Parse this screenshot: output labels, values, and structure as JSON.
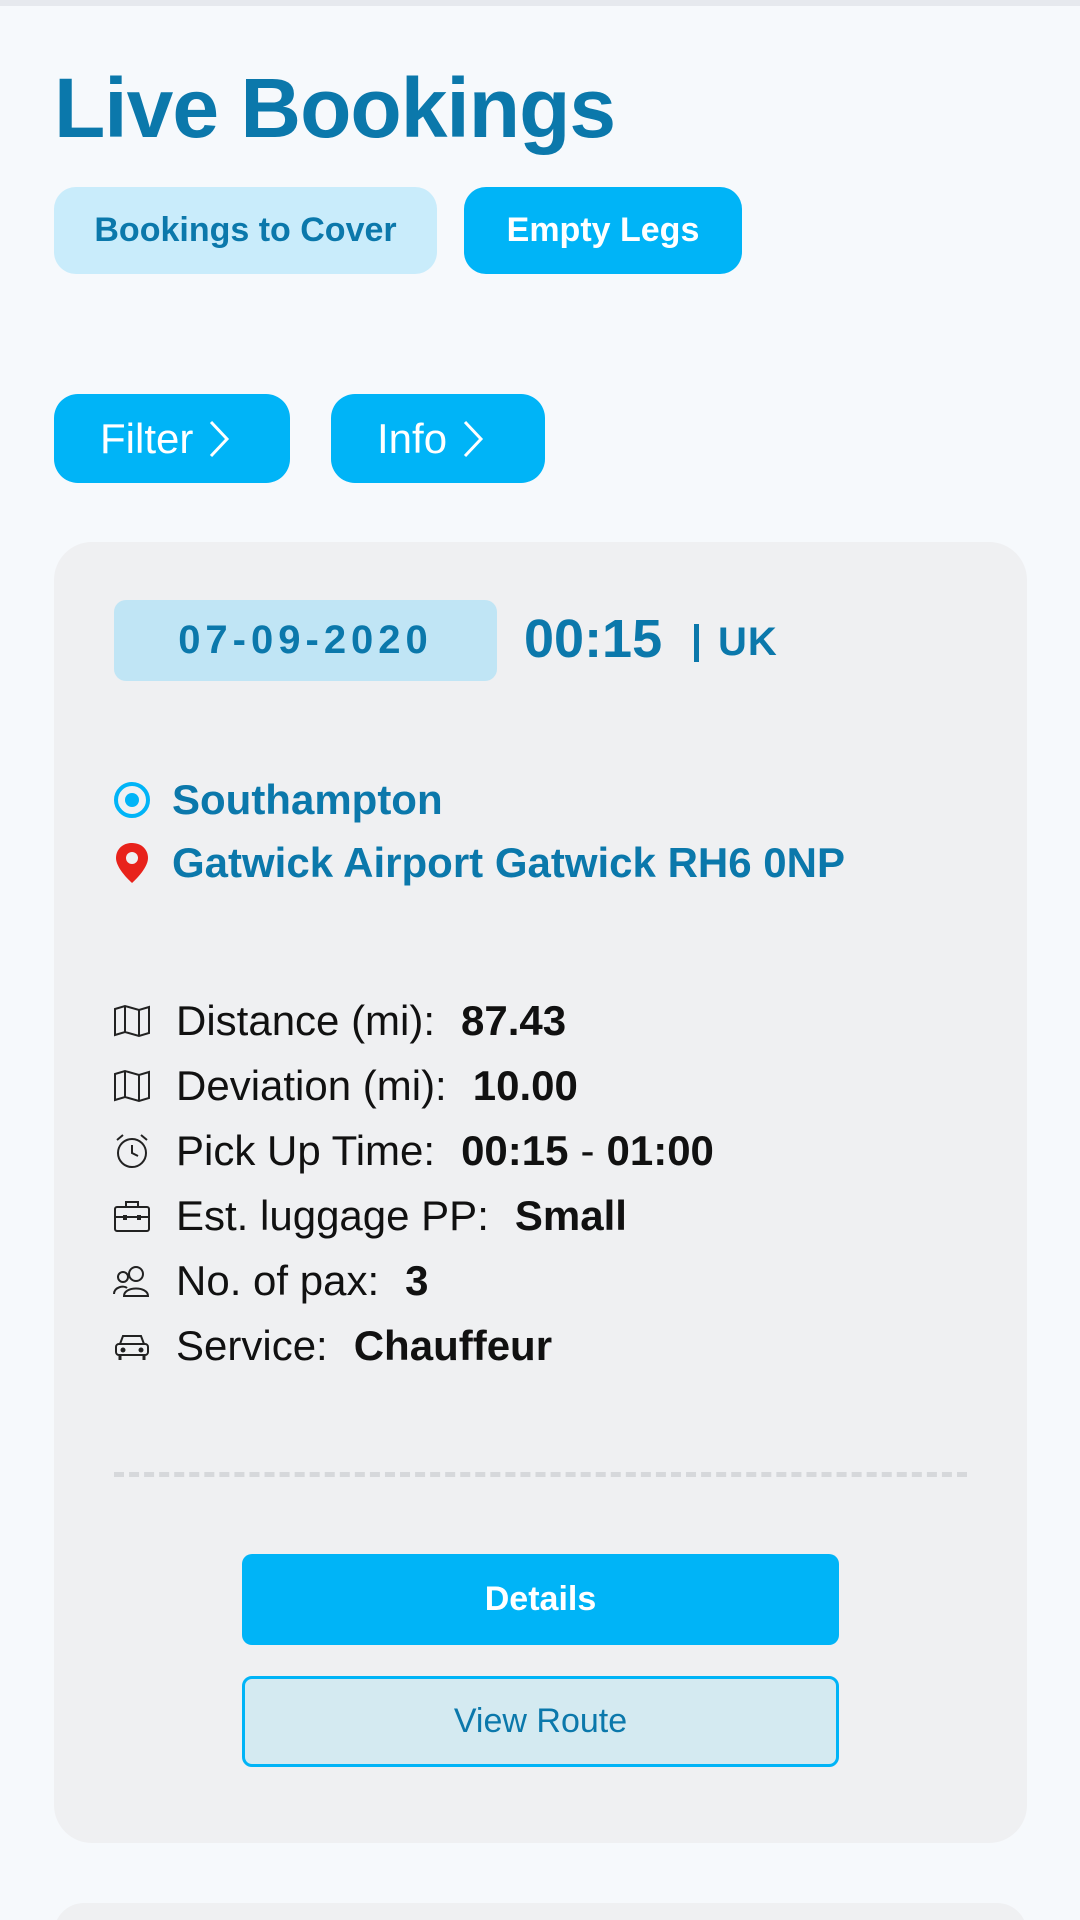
{
  "page": {
    "title": "Live Bookings"
  },
  "tabs": [
    {
      "label": "Bookings to Cover",
      "active": false
    },
    {
      "label": "Empty Legs",
      "active": true
    }
  ],
  "actions": {
    "filter_label": "Filter",
    "info_label": "Info"
  },
  "booking": {
    "date": "07-09-2020",
    "time": "00:15",
    "region": "UK",
    "from": "Southampton",
    "to": "Gatwick Airport Gatwick RH6 0NP",
    "details": [
      {
        "icon": "map-icon",
        "label": "Distance (mi):",
        "value": "87.43"
      },
      {
        "icon": "map-icon",
        "label": "Deviation (mi):",
        "value": "10.00"
      },
      {
        "icon": "alarm-clock-icon",
        "label": "Pick Up Time:",
        "value_start": "00:15",
        "value_sep": "-",
        "value_end": "01:00"
      },
      {
        "icon": "briefcase-icon",
        "label": "Est. luggage PP:",
        "value": "Small"
      },
      {
        "icon": "users-icon",
        "label": "No. of pax:",
        "value": "3"
      },
      {
        "icon": "car-icon",
        "label": "Service:",
        "value": "Chauffeur"
      }
    ],
    "details_button": "Details",
    "route_button": "View Route"
  },
  "colors": {
    "primary": "#00b4f7",
    "heading": "#0b78ab",
    "tab_inactive_bg": "#c9ecfb",
    "card_bg": "#eff0f2",
    "destination_pin": "#e8221b"
  }
}
